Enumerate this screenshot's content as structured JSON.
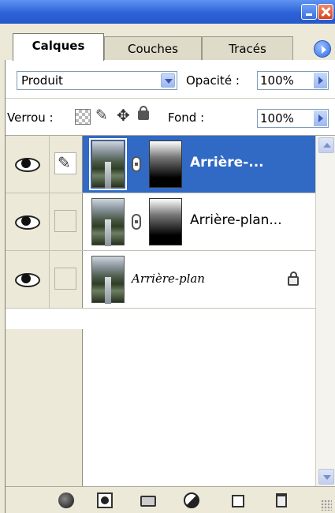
{
  "titlebar": {
    "minimize_icon": "minimize-icon",
    "close_icon": "close-icon",
    "accent_color": "#2d62d8"
  },
  "tabs": [
    {
      "label": "Calques",
      "active": true
    },
    {
      "label": "Couches",
      "active": false
    },
    {
      "label": "Tracés",
      "active": false
    }
  ],
  "options": {
    "blend_mode": "Produit",
    "opacity_label": "Opacité :",
    "opacity_value": "100%",
    "lock_label": "Verrou :",
    "fill_label": "Fond :",
    "fill_value": "100%"
  },
  "layers": [
    {
      "name": "Arrière-...",
      "selected": true,
      "visible": true,
      "has_mask": true,
      "selection_color": "#316ac5"
    },
    {
      "name": "Arrière-plan...",
      "selected": false,
      "visible": true,
      "has_mask": true
    },
    {
      "name": "Arrière-plan",
      "selected": false,
      "visible": true,
      "has_mask": false,
      "locked": true
    }
  ],
  "bottom_toolbar": [
    "layer-style-icon",
    "add-mask-icon",
    "new-group-icon",
    "adjustment-layer-icon",
    "new-layer-icon",
    "delete-layer-icon"
  ]
}
